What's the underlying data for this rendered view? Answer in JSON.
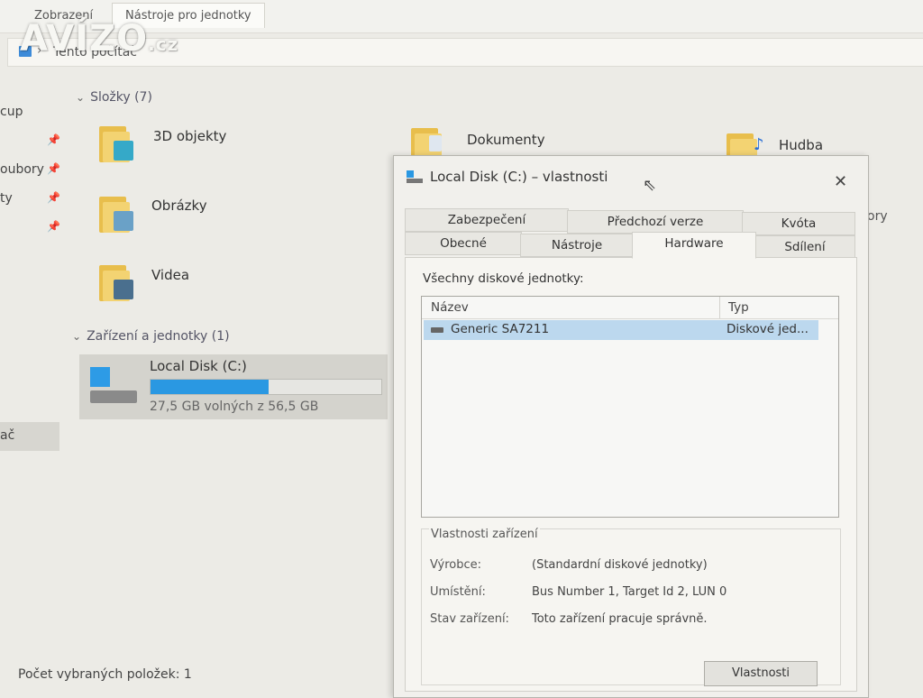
{
  "ribbon": {
    "tabs": [
      "Zobrazení",
      "Nástroje pro jednotky"
    ]
  },
  "watermark": {
    "text": "AVÍZO",
    "suffix": ".cz"
  },
  "address": {
    "path": "Tento počítač"
  },
  "sidebar": {
    "items": [
      "cup",
      "oubory",
      "ty",
      "ač"
    ]
  },
  "folders_group": {
    "label": "Složky (7)",
    "items": [
      {
        "name": "3D objekty"
      },
      {
        "name": "Obrázky"
      },
      {
        "name": "Videa"
      },
      {
        "name": "Dokumenty"
      },
      {
        "name": "Hudba"
      }
    ]
  },
  "devices_group": {
    "label": "Zařízení a jednotky (1)",
    "drive": {
      "name": "Local Disk (C:)",
      "free_text": "27,5 GB volných z 56,5 GB",
      "used_fraction": 0.51
    }
  },
  "background_fragments": {
    "right_partial": "ory"
  },
  "status_bar": {
    "text": "Počet vybraných položek: 1"
  },
  "dialog": {
    "title": "Local Disk (C:) – vlastnosti",
    "close": "✕",
    "tabs_row1": [
      "Zabezpečení",
      "Předchozí verze",
      "Kvóta"
    ],
    "tabs_row2": [
      "Obecné",
      "Nástroje",
      "Hardware",
      "Sdílení"
    ],
    "active_tab": "Hardware",
    "list_label": "Všechny diskové jednotky:",
    "list": {
      "columns": [
        "Název",
        "Typ"
      ],
      "rows": [
        {
          "name": "Generic SA7211",
          "type": "Diskové jed..."
        }
      ]
    },
    "device_props": {
      "legend": "Vlastnosti zařízení",
      "manufacturer_label": "Výrobce:",
      "manufacturer_value": "(Standardní diskové jednotky)",
      "location_label": "Umístění:",
      "location_value": "Bus Number 1, Target Id 2, LUN 0",
      "status_label": "Stav zařízení:",
      "status_value": "Toto zařízení pracuje správně."
    },
    "properties_button": "Vlastnosti"
  },
  "colors": {
    "accent": "#2a98e2",
    "selection": "#bcd8ee",
    "folder": "#f3d372"
  }
}
